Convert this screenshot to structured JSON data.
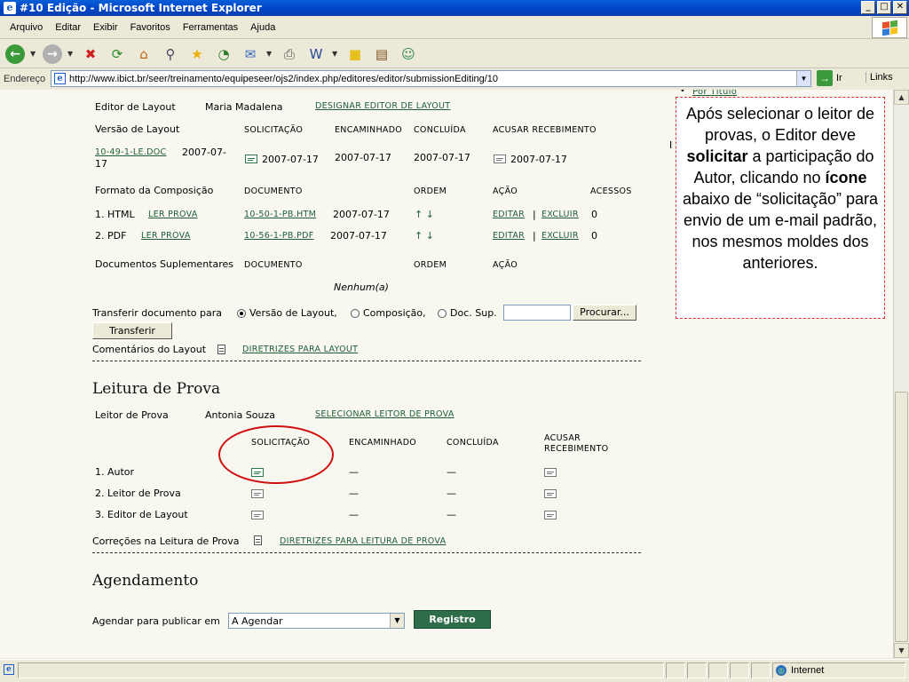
{
  "window": {
    "title": "#10 Edição - Microsoft Internet Explorer",
    "buttons": {
      "minimize": "_",
      "maximize": "□",
      "close": "✕"
    }
  },
  "menu": {
    "items": [
      "Arquivo",
      "Editar",
      "Exibir",
      "Favoritos",
      "Ferramentas",
      "Ajuda"
    ]
  },
  "toolbar": {
    "icons": [
      "back-icon",
      "forward-icon",
      "stop-icon",
      "refresh-icon",
      "home-icon",
      "search-icon",
      "favorites-icon",
      "history-icon",
      "mail-icon",
      "print-icon",
      "edit-icon",
      "discuss-icon",
      "research-icon",
      "messenger-icon"
    ]
  },
  "address": {
    "label": "Endereço",
    "url": "http://www.ibict.br/seer/treinamento/equipeseer/ojs2/index.php/editores/editor/submissionEditing/10",
    "go_label": "Ir",
    "links_label": "Links"
  },
  "layout_section": {
    "top_link": "Por Título",
    "editor_label": "Editor de Layout",
    "editor_name": "Maria Madalena",
    "designate_link": "DESIGNAR EDITOR DE LAYOUT",
    "version_label": "Versão de Layout",
    "cols": {
      "request": "SOLICITAÇÃO",
      "forwarded": "ENCAMINHADO",
      "completed": "CONCLUÍDA",
      "ack": "ACUSAR RECEBIMENTO"
    },
    "version_file": "10-49-1-LE.DOC",
    "version_file_date_a": "2007-07-",
    "version_file_date_b": "17",
    "version_request_date": "2007-07-17",
    "version_forwarded_date": "2007-07-17",
    "version_completed_date": "2007-07-17",
    "version_ack_date": "2007-07-17",
    "composition_label": "Formato da Composição",
    "comp_cols": {
      "document": "DOCUMENTO",
      "order": "ORDEM",
      "action": "AÇÃO",
      "access": "ACESSOS"
    },
    "formats": [
      {
        "label": "1.  HTML",
        "read": "LER PROVA",
        "file": "10-50-1-PB.HTM",
        "date": "2007-07-17",
        "order": "↑ ↓",
        "edit": "EDITAR",
        "sep": "|",
        "delete": "EXCLUIR",
        "access": "0"
      },
      {
        "label": "2.  PDF",
        "read": "LER PROVA",
        "file": "10-56-1-PB.PDF",
        "date": "2007-07-17",
        "order": "↑ ↓",
        "edit": "EDITAR",
        "sep": "|",
        "delete": "EXCLUIR",
        "access": "0"
      }
    ],
    "supp_label": "Documentos Suplementares",
    "supp_cols": {
      "document": "DOCUMENTO",
      "order": "ORDEM",
      "action": "AÇÃO"
    },
    "supp_none": "Nenhum(a)",
    "transfer_label": "Transferir documento para",
    "transfer_opts": [
      "Versão de Layout,",
      "Composição,",
      "Doc. Sup."
    ],
    "browse_label": "Procurar...",
    "transfer_button": "Transferir",
    "comments_label": "Comentários do Layout",
    "guidelines_link": "DIRETRIZES PARA LAYOUT"
  },
  "proof_section": {
    "heading": "Leitura de Prova",
    "reader_label": "Leitor de Prova",
    "reader_name": "Antonia Souza",
    "select_link": "SELECIONAR LEITOR DE PROVA",
    "cols": {
      "request": "SOLICITAÇÃO",
      "forwarded": "ENCAMINHADO",
      "completed": "CONCLUÍDA",
      "ack_a": "ACUSAR",
      "ack_b": "RECEBIMENTO"
    },
    "rows": [
      {
        "label": "1.  Autor",
        "forwarded": "—",
        "completed": "—"
      },
      {
        "label": "2.  Leitor de Prova",
        "forwarded": "—",
        "completed": "—"
      },
      {
        "label": "3.  Editor de Layout",
        "forwarded": "—",
        "completed": "—"
      }
    ],
    "corrections_label": "Correções na Leitura de Prova",
    "guidelines_link": "DIRETRIZES PARA LEITURA DE PROVA"
  },
  "schedule_section": {
    "heading": "Agendamento",
    "label": "Agendar para publicar em",
    "selected": "A Agendar",
    "button": "Registro"
  },
  "callout": {
    "part1": "Após selecionar o leitor de provas, o Editor deve ",
    "bold1": "solicitar",
    "part2": " a participação do Autor, clicando no ",
    "bold2": "ícone",
    "part3": " abaixo de “solicitação” para envio de um e-mail padrão, nos mesmos moldes dos anteriores."
  },
  "status": {
    "zone": "Internet"
  }
}
